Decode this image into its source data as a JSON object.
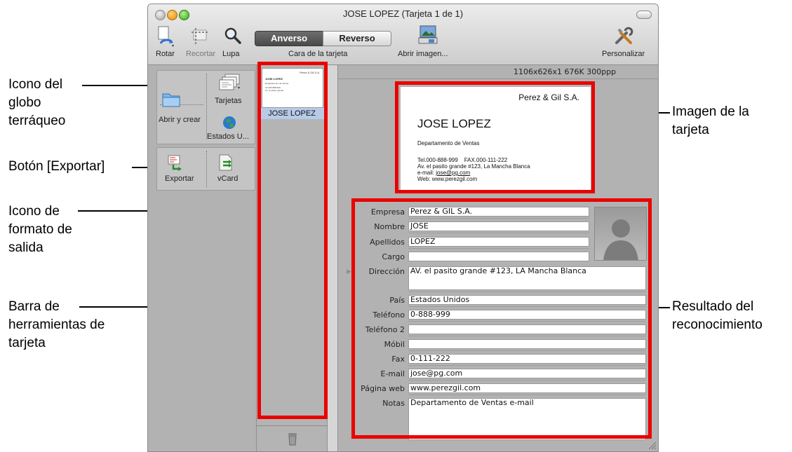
{
  "window": {
    "title": "JOSE LOPEZ (Tarjeta 1 de 1)"
  },
  "toolbar": {
    "rotate_label": "Rotar",
    "crop_label": "Recortar",
    "zoom_label": "Lupa",
    "front_label": "Anverso",
    "back_label": "Reverso",
    "side_label": "Cara de la tarjeta",
    "open_image_label": "Abrir imagen...",
    "customize_label": "Personalizar"
  },
  "sidebar": {
    "open_create_label": "Abrir y crear",
    "cards_label": "Tarjetas",
    "country_label": "Estados U...",
    "export_label": "Exportar",
    "vcard_label": "vCard"
  },
  "card_list": {
    "items": [
      {
        "label": "JOSE LOPEZ"
      }
    ],
    "thumb_lines": [
      "JOSE LOPEZ",
      "Departamento de Ventas",
      "Tel.000-888-999",
      "Av. el pasito grande"
    ]
  },
  "image_info": "1106x626x1  676K  300ppp",
  "business_card": {
    "company": "Perez & Gil S.A.",
    "name": "JOSE LOPEZ",
    "department": "Departamento de Ventas",
    "phones": "Tel.000-888-999    FAX.000-111-222",
    "address": "Av. el pasito grande #123, La Mancha Blanca",
    "email_prefix": "e-mail: ",
    "email": "jose@pg.com",
    "web": "Web: www.perezgil.com"
  },
  "fields": [
    {
      "label": "Empresa",
      "value": "Perez & GIL S.A."
    },
    {
      "label": "Nombre",
      "value": "JOSE"
    },
    {
      "label": "Apellidos",
      "value": "LOPEZ"
    },
    {
      "label": "Cargo",
      "value": ""
    },
    {
      "label": "Dirección",
      "value": "AV. el pasito grande #123, LA Mancha Blanca"
    },
    {
      "label": "País",
      "value": "Estados Unidos"
    },
    {
      "label": "Teléfono",
      "value": "0-888-999"
    },
    {
      "label": "Teléfono 2",
      "value": ""
    },
    {
      "label": "Móbil",
      "value": ""
    },
    {
      "label": "Fax",
      "value": "0-111-222"
    },
    {
      "label": "E-mail",
      "value": "jose@pg.com"
    },
    {
      "label": "Página web",
      "value": "www.perezgil.com"
    },
    {
      "label": "Notas",
      "value": "Departamento de Ventas e-mail"
    }
  ],
  "callouts": {
    "globe_icon": "Icono del\nglobo\nterráqueo",
    "export_button": "Botón [Exportar]",
    "output_format": "Icono de\nformato de\nsalida",
    "card_toolbar": "Barra de\nherramientas de\ntarjeta",
    "card_image": "Imagen de la\ntarjeta",
    "recognition": "Resultado del\nreconocimiento"
  },
  "colors": {
    "highlight": "#ea0000",
    "selection": "#b7cbe8",
    "window_bg": "#b4b4b4"
  }
}
